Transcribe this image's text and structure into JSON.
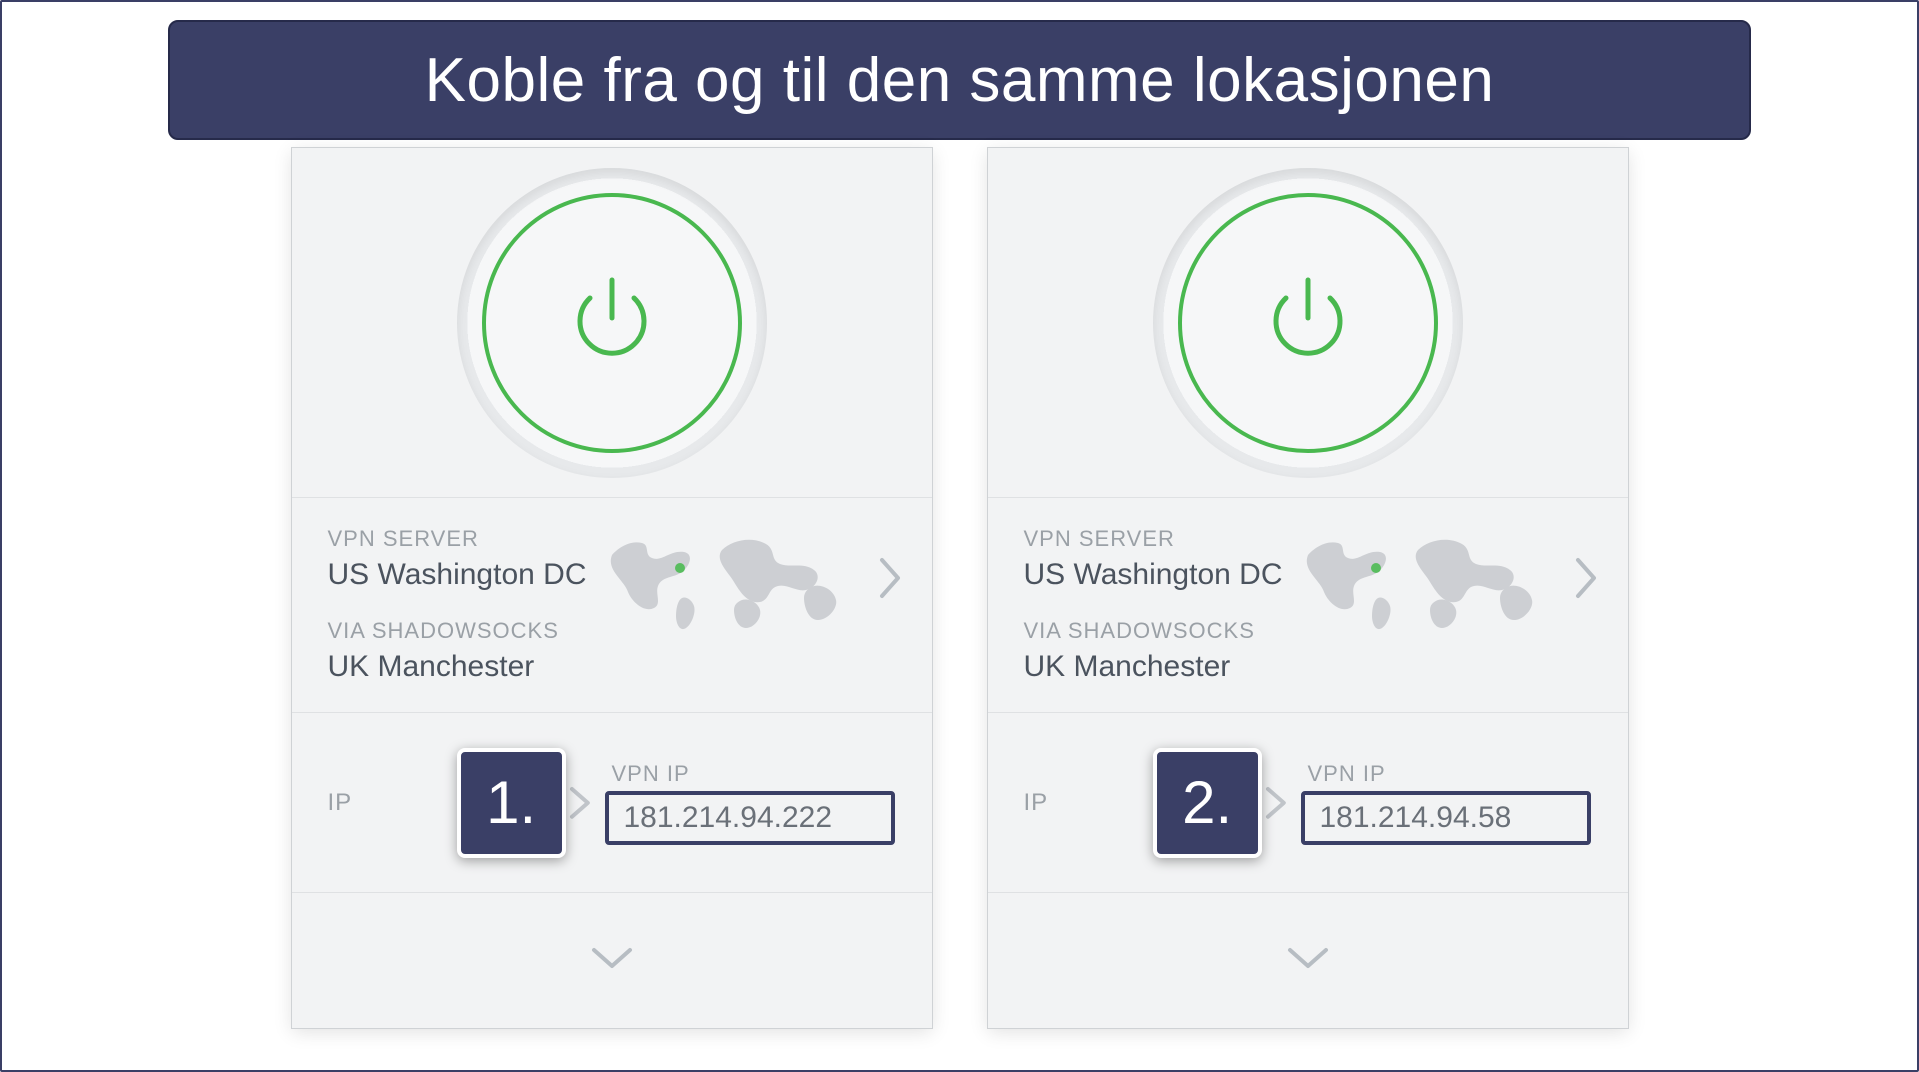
{
  "banner": {
    "title": "Koble fra og til den samme lokasjonen"
  },
  "cards": [
    {
      "step_label": "1.",
      "server_label": "VPN SERVER",
      "server_value": "US Washington DC",
      "via_label": "VIA SHADOWSOCKS",
      "via_value": "UK Manchester",
      "ip_label": "IP",
      "vpn_ip_label": "VPN IP",
      "vpn_ip_value": "181.214.94.222"
    },
    {
      "step_label": "2.",
      "server_label": "VPN SERVER",
      "server_value": "US Washington DC",
      "via_label": "VIA SHADOWSOCKS",
      "via_value": "UK Manchester",
      "ip_label": "IP",
      "vpn_ip_label": "VPN IP",
      "vpn_ip_value": "181.214.94.58"
    }
  ]
}
